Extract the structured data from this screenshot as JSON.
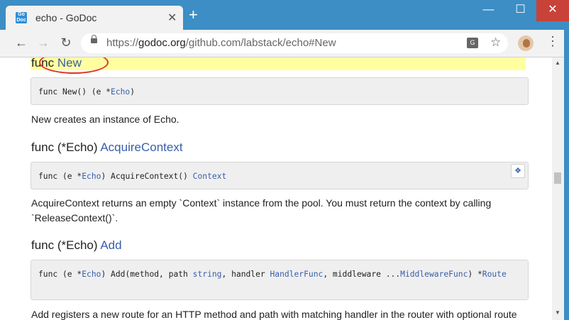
{
  "browser": {
    "tab": {
      "favicon_text": "Go\nDoc",
      "title": "echo - GoDoc",
      "close": "✕"
    },
    "new_tab": "+",
    "window_controls": {
      "minimize": "—",
      "maximize": "☐",
      "close": "✕"
    },
    "nav": {
      "back": "←",
      "forward": "→",
      "reload": "↻"
    },
    "url": {
      "scheme": "https://",
      "host": "godoc.org",
      "path": "/github.com/labstack/echo#New"
    },
    "icons": [
      "translate-icon",
      "bookmark-star-icon",
      "profile-avatar",
      "menu-icon"
    ],
    "menu": "⋮",
    "star": "☆",
    "translate": "G"
  },
  "colors": {
    "titlebar": "#3c8ec4",
    "link": "#375eab",
    "highlight": "#ffffa0",
    "annotation": "#e0322d"
  },
  "doc": {
    "func_new": {
      "keyword": "func",
      "name": "New",
      "signature": {
        "prefix": "func New() (e *",
        "type": "Echo",
        "suffix": ")"
      },
      "description": "New creates an instance of Echo."
    },
    "func_acquire": {
      "keyword": "func (*Echo)",
      "name": "AcquireContext",
      "signature": {
        "p1": "func (e *",
        "t1": "Echo",
        "p2": ") AcquireContext() ",
        "t2": "Context"
      },
      "expand": "❖",
      "description": "AcquireContext returns an empty `Context` instance from the pool. You must return the context by calling `ReleaseContext()`."
    },
    "func_add": {
      "keyword": "func (*Echo)",
      "name": "Add",
      "signature": {
        "p1": "func (e *",
        "t1": "Echo",
        "p2": ") Add(method, path ",
        "t2": "string",
        "p3": ", handler ",
        "t3": "HandlerFunc",
        "p4": ", middleware ...",
        "t4": "MiddlewareFunc",
        "p5": ") *",
        "t5": "Route"
      },
      "description": "Add registers a new route for an HTTP method and path with matching handler in the router with optional route"
    }
  }
}
